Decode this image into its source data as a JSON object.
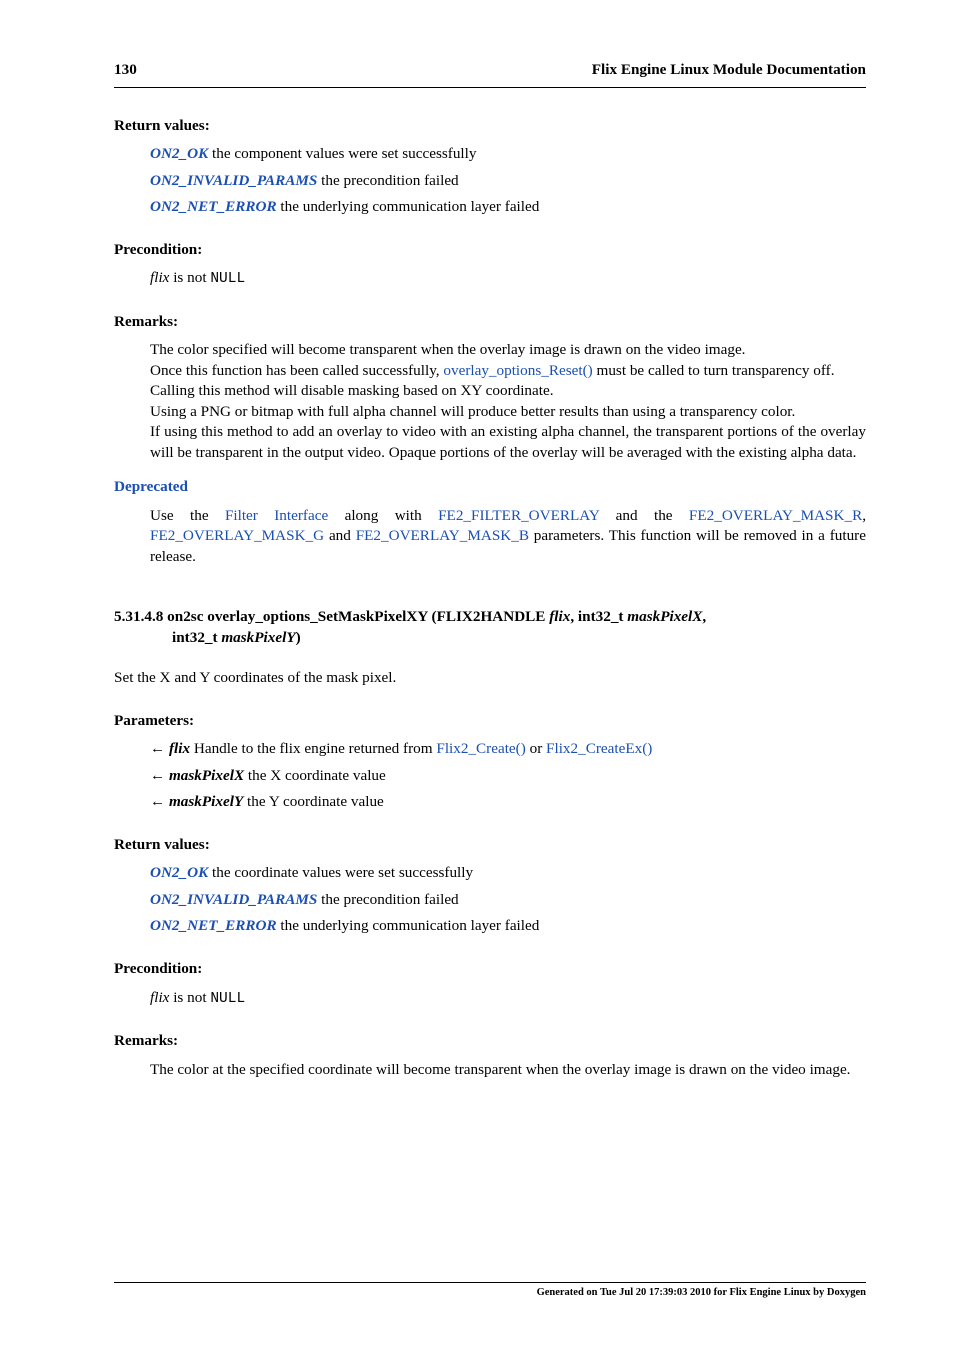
{
  "header": {
    "page_number": "130",
    "title": "Flix Engine Linux Module Documentation"
  },
  "sec1": {
    "title": "Return values:",
    "rv1a": "ON2_OK",
    "rv1b": "  the component values were set successfully",
    "rv2a": "ON2_INVALID_PARAMS",
    "rv2b": "  the precondition failed",
    "rv3a": "ON2_NET_ERROR",
    "rv3b": "  the underlying communication layer failed"
  },
  "sec2": {
    "title": "Precondition:",
    "line_a": "flix",
    "line_b": " is not ",
    "line_c": "NULL"
  },
  "sec3": {
    "title": "Remarks:",
    "p1": "The color specified will become transparent when the overlay image is drawn on the video image.",
    "p2a": "Once this function has been called successfully, ",
    "p2b": "overlay_options_Reset()",
    "p2c": " must be called to turn transparency off.",
    "p3": "Calling this method will disable masking based on XY coordinate.",
    "p4": "Using a PNG or bitmap with full alpha channel will produce better results than using a transparency color.",
    "p5": "If using this method to add an overlay to video with an existing alpha channel, the transparent portions of the overlay will be transparent in the output video. Opaque portions of the overlay will be averaged with the existing alpha data."
  },
  "dep": {
    "title": "Deprecated",
    "t1": "Use the ",
    "t2": "Filter Interface",
    "t3": " along with ",
    "t4": "FE2_FILTER_OVERLAY",
    "t5": " and the ",
    "t6": "FE2_OVERLAY_MASK_R",
    "t7": ", ",
    "t8": "FE2_OVERLAY_MASK_G",
    "t9": " and ",
    "t10": "FE2_OVERLAY_MASK_B",
    "t11": " parameters. This function will be removed in a future release."
  },
  "sub": {
    "num": "5.31.4.8",
    "sig1": "   on2sc overlay_options_SetMaskPixelXY (FLIX2HANDLE ",
    "sig2": "flix",
    "sig3": ", int32_t ",
    "sig4": "maskPixelX",
    "sig5": ",",
    "sig_line2a": "int32_t ",
    "sig_line2b": "maskPixelY",
    "sig_line2c": ")",
    "desc": "Set the X and Y coordinates of the mask pixel."
  },
  "params": {
    "title": "Parameters:",
    "arrow": "←",
    "p1a": "flix",
    "p1b": "  Handle to the flix engine returned from ",
    "p1c": "Flix2_Create()",
    "p1d": " or ",
    "p1e": "Flix2_CreateEx()",
    "p2a": "maskPixelX",
    "p2b": "  the X coordinate value",
    "p3a": "maskPixelY",
    "p3b": "  the Y coordinate value"
  },
  "sec4": {
    "title": "Return values:",
    "rv1a": "ON2_OK",
    "rv1b": "  the coordinate values were set successfully",
    "rv2a": "ON2_INVALID_PARAMS",
    "rv2b": "  the precondition failed",
    "rv3a": "ON2_NET_ERROR",
    "rv3b": "  the underlying communication layer failed"
  },
  "sec5": {
    "title": "Precondition:",
    "line_a": "flix",
    "line_b": " is not ",
    "line_c": "NULL"
  },
  "sec6": {
    "title": "Remarks:",
    "p1": "The color at the specified coordinate will become transparent when the overlay image is drawn on the video image."
  },
  "footer": {
    "text": "Generated on Tue Jul 20 17:39:03 2010 for Flix Engine Linux by Doxygen"
  }
}
